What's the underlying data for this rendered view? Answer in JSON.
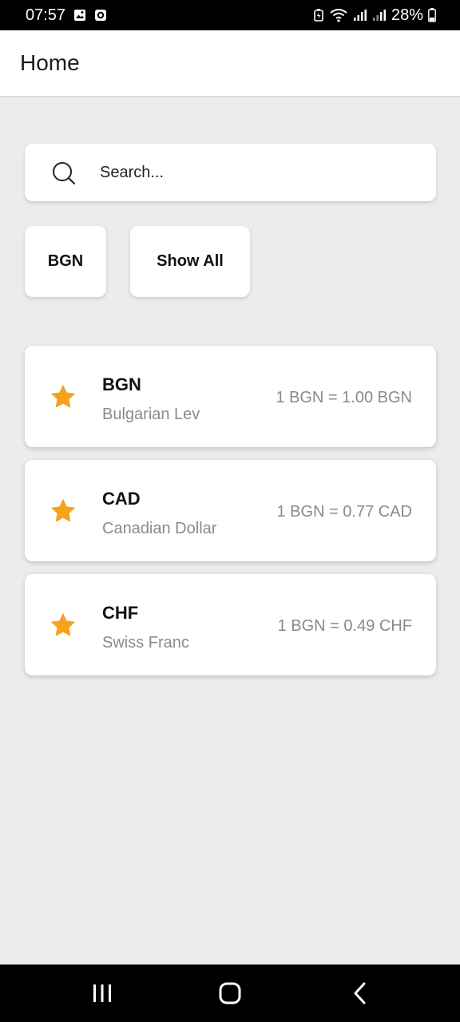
{
  "status_bar": {
    "time": "07:57",
    "battery": "28%",
    "icons": [
      "gallery-icon",
      "notification-icon",
      "battery-saver-icon",
      "wifi-icon",
      "signal-icon",
      "signal-icon-2",
      "battery-icon"
    ]
  },
  "app_bar": {
    "title": "Home"
  },
  "search": {
    "placeholder": "Search...",
    "value": ""
  },
  "filters": [
    {
      "label": "BGN"
    },
    {
      "label": "Show All"
    }
  ],
  "currencies": [
    {
      "code": "BGN",
      "name": "Bulgarian Lev",
      "rate": "1 BGN = 1.00 BGN",
      "favorite": true
    },
    {
      "code": "CAD",
      "name": "Canadian Dollar",
      "rate": "1 BGN = 0.77 CAD",
      "favorite": true
    },
    {
      "code": "CHF",
      "name": "Swiss Franc",
      "rate": "1 BGN = 0.49 CHF",
      "favorite": true
    }
  ],
  "colors": {
    "star": "#f6a21e",
    "background": "#ecebed",
    "secondary_text": "#8a8a8a"
  },
  "nav_bar": {
    "icons": [
      "recent-apps-icon",
      "home-icon",
      "back-icon"
    ]
  }
}
